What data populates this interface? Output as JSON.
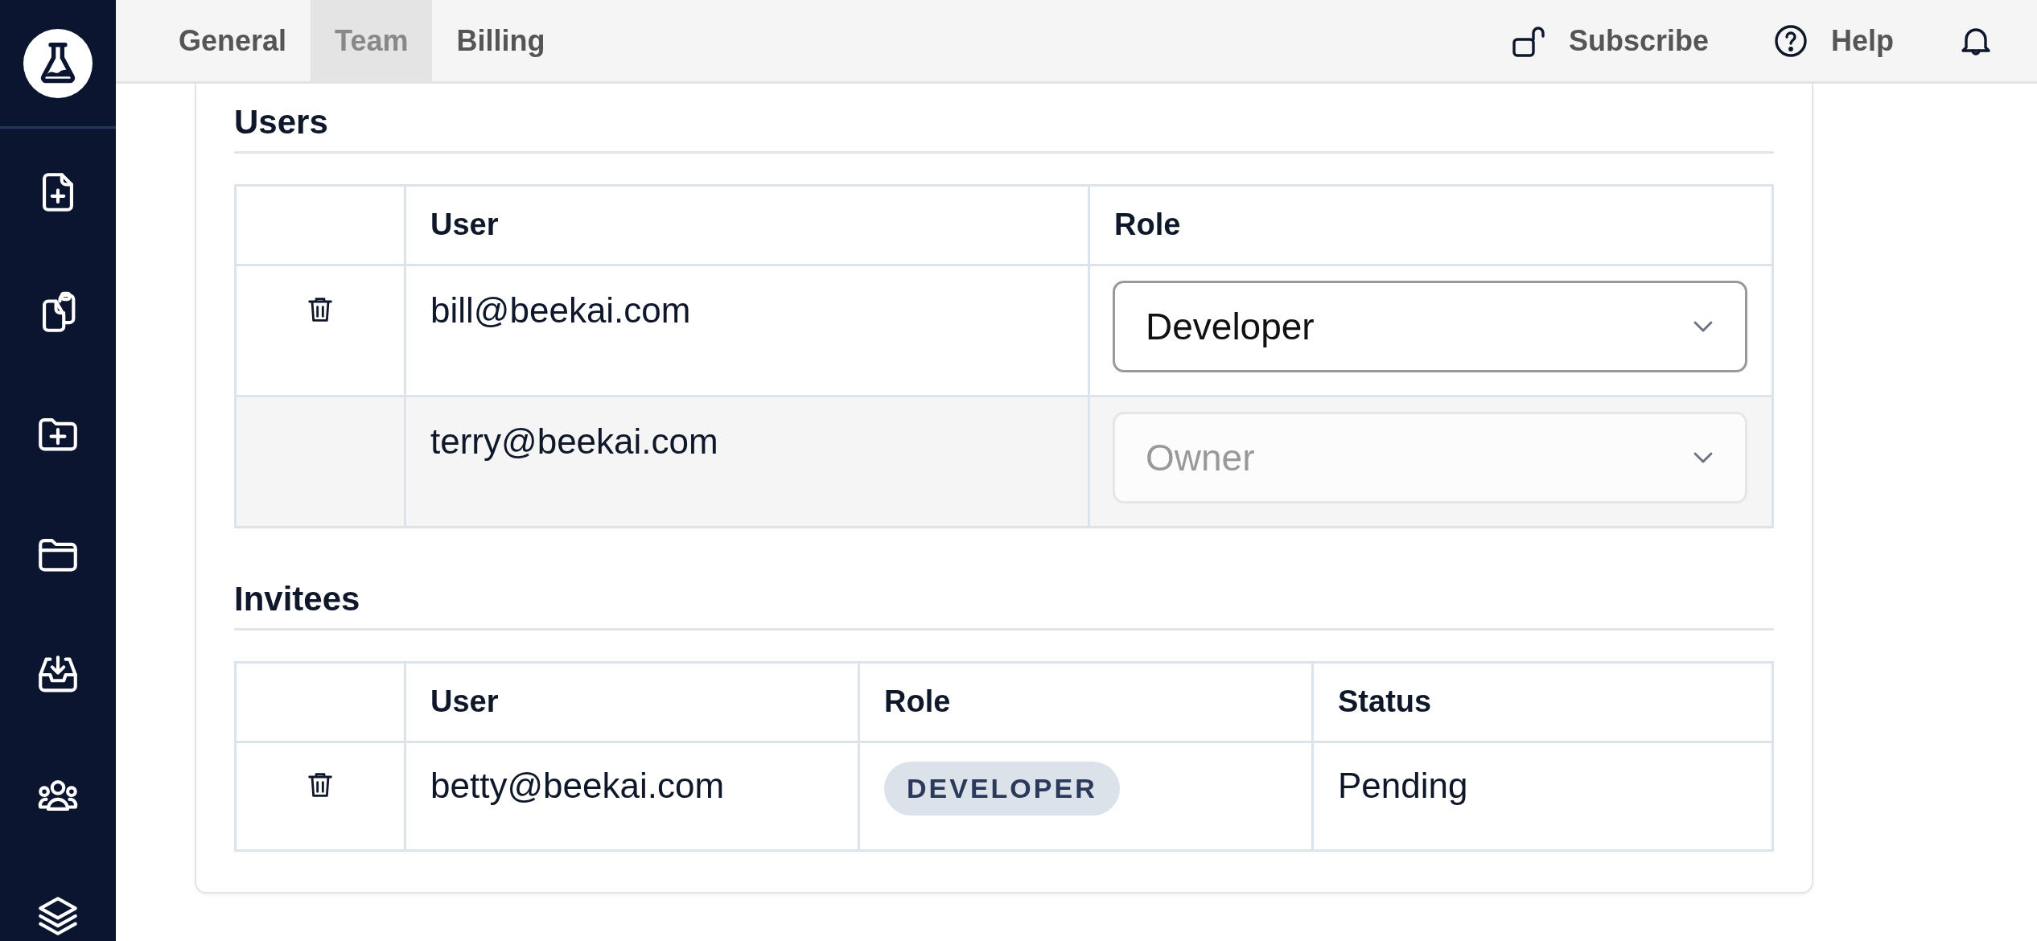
{
  "tabs": [
    {
      "label": "General",
      "selected": false
    },
    {
      "label": "Team",
      "selected": true
    },
    {
      "label": "Billing",
      "selected": false
    }
  ],
  "header_actions": [
    {
      "kind": "subscribe",
      "label": "Subscribe"
    },
    {
      "kind": "help",
      "label": "Help"
    },
    {
      "kind": "notifications"
    }
  ],
  "users": {
    "title": "Users",
    "columns": [
      "User",
      "Role"
    ],
    "rows": [
      {
        "user": "bill@beekai.com",
        "role": "Developer",
        "deletable": true,
        "disabled": false
      },
      {
        "user": "terry@beekai.com",
        "role": "Owner",
        "deletable": false,
        "disabled": true
      }
    ]
  },
  "invitees": {
    "title": "Invitees",
    "columns": [
      "User",
      "Role",
      "Status"
    ],
    "rows": [
      {
        "user": "betty@beekai.com",
        "role": "DEVELOPER",
        "status": "Pending",
        "deletable": true
      }
    ]
  }
}
